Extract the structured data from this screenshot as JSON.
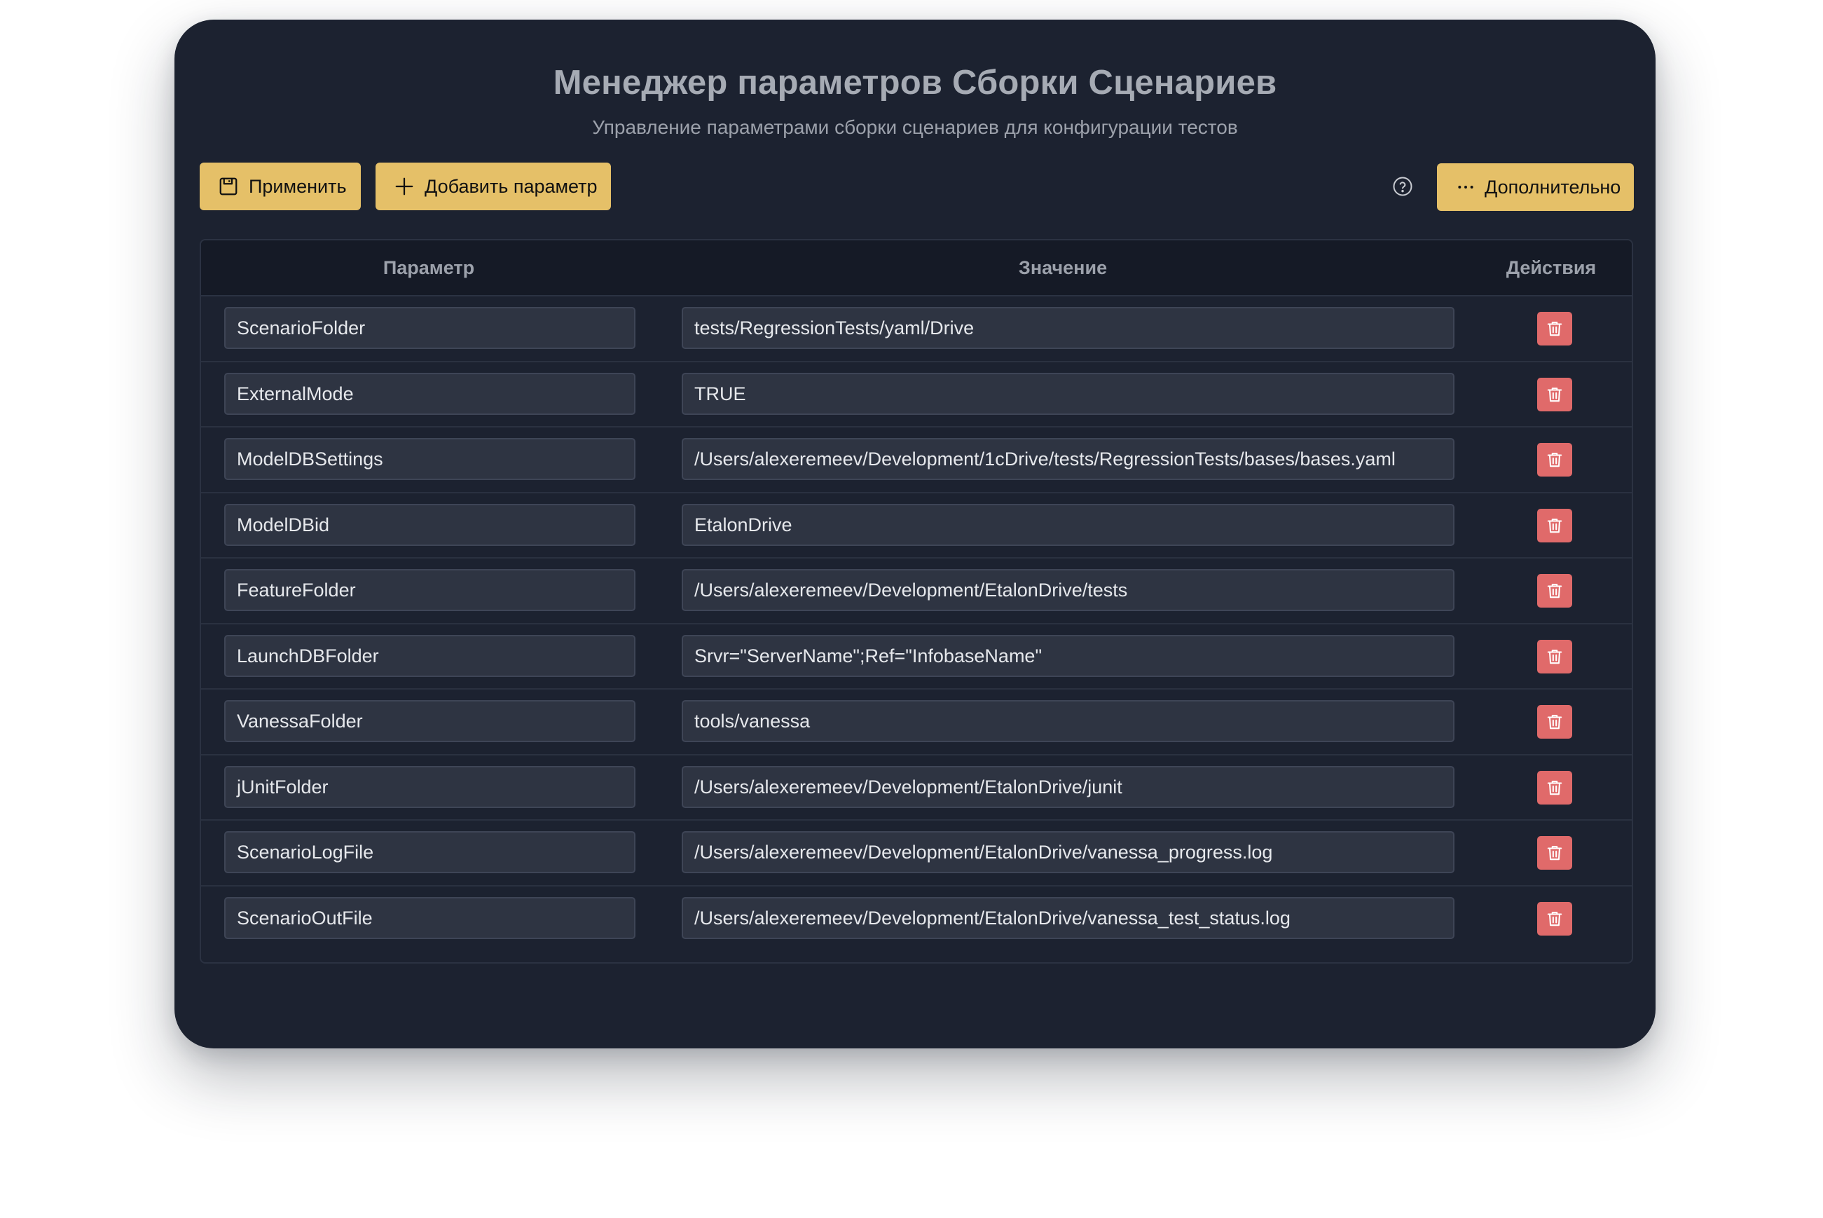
{
  "header": {
    "title": "Менеджер параметров Сборки Сценариев",
    "subtitle": "Управление параметрами сборки сценариев для конфигурации тестов"
  },
  "toolbar": {
    "apply_label": "Применить",
    "add_label": "Добавить параметр",
    "more_label": "Дополнительно",
    "apply_icon": "save-icon",
    "add_icon": "plus-icon",
    "more_icon": "ellipsis-icon",
    "help_icon": "question-circle-icon"
  },
  "table": {
    "columns": [
      "Параметр",
      "Значение",
      "Действия"
    ],
    "delete_icon": "trash-icon",
    "rows": [
      {
        "name": "ScenarioFolder",
        "value": "tests/RegressionTests/yaml/Drive"
      },
      {
        "name": "ExternalMode",
        "value": "TRUE"
      },
      {
        "name": "ModelDBSettings",
        "value": "/Users/alexeremeev/Development/1cDrive/tests/RegressionTests/bases/bases.yaml"
      },
      {
        "name": "ModelDBid",
        "value": "EtalonDrive"
      },
      {
        "name": "FeatureFolder",
        "value": "/Users/alexeremeev/Development/EtalonDrive/tests"
      },
      {
        "name": "LaunchDBFolder",
        "value": "Srvr=\"ServerName\";Ref=\"InfobaseName\""
      },
      {
        "name": "VanessaFolder",
        "value": "tools/vanessa"
      },
      {
        "name": "jUnitFolder",
        "value": "/Users/alexeremeev/Development/EtalonDrive/junit"
      },
      {
        "name": "ScenarioLogFile",
        "value": "/Users/alexeremeev/Development/EtalonDrive/vanessa_progress.log"
      },
      {
        "name": "ScenarioOutFile",
        "value": "/Users/alexeremeev/Development/EtalonDrive/vanessa_test_status.log"
      }
    ]
  },
  "colors": {
    "panel_bg": "#1c2230",
    "accent": "#e5c068",
    "danger": "#e06a6a",
    "input_bg": "#2e3442"
  }
}
